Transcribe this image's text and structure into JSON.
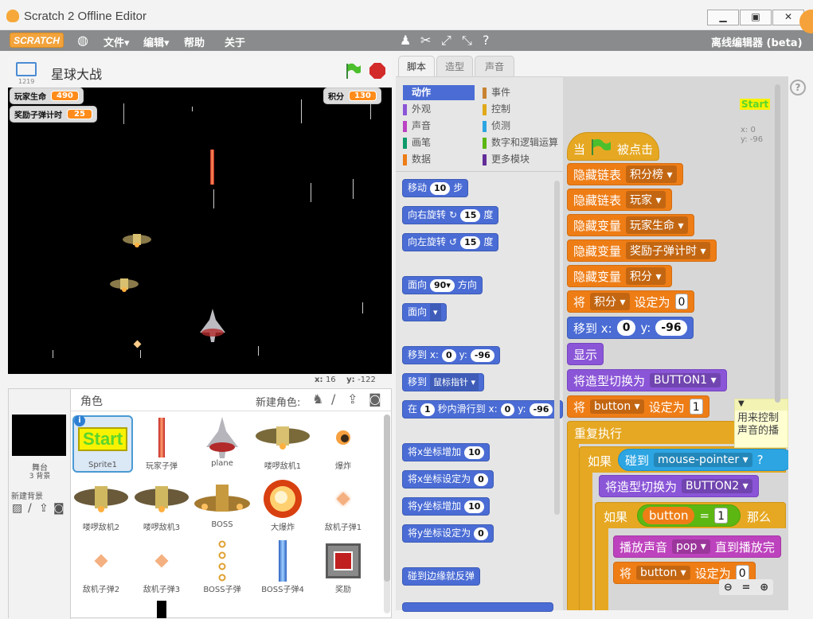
{
  "window": {
    "title": "Scratch 2 Offline Editor"
  },
  "menu": {
    "logo": "SCRATCH",
    "file": "文件▾",
    "edit": "编辑▾",
    "help": "帮助",
    "about": "关于",
    "offline": "离线编辑器 (beta)"
  },
  "stage": {
    "version": "1219",
    "project_name": "星球大战",
    "mouse_x_label": "x:",
    "mouse_x": "16",
    "mouse_y_label": "y:",
    "mouse_y": "-122"
  },
  "monitors": [
    {
      "label": "玩家生命",
      "value": "490"
    },
    {
      "label": "奖励子弹计时",
      "value": "25"
    },
    {
      "label": "积分",
      "value": "130"
    }
  ],
  "sprites_pane": {
    "title": "角色",
    "new_sprite": "新建角色:",
    "stage_label": "舞台",
    "stage_count": "3 背景",
    "new_backdrop": "新建背景"
  },
  "sprites": [
    {
      "name": "Sprite1",
      "selected": true
    },
    {
      "name": "玩家子弹"
    },
    {
      "name": "plane"
    },
    {
      "name": "喽啰敌机1"
    },
    {
      "name": "爆炸"
    },
    {
      "name": "喽啰敌机2"
    },
    {
      "name": "喽啰敌机3"
    },
    {
      "name": "BOSS"
    },
    {
      "name": "大爆炸"
    },
    {
      "name": "敌机子弹1"
    },
    {
      "name": "敌机子弹2"
    },
    {
      "name": "敌机子弹3"
    },
    {
      "name": "BOSS子弹"
    },
    {
      "name": "BOSS子弹4"
    },
    {
      "name": "奖励"
    }
  ],
  "sprite_start_text": "Start",
  "tabs": {
    "scripts": "脚本",
    "costumes": "造型",
    "sounds": "声音"
  },
  "categories": {
    "left": [
      {
        "label": "动作",
        "color": "#4a6cd4",
        "selected": true
      },
      {
        "label": "外观",
        "color": "#8a55d7"
      },
      {
        "label": "声音",
        "color": "#bb42c3"
      },
      {
        "label": "画笔",
        "color": "#0e9a6c"
      },
      {
        "label": "数据",
        "color": "#ee7d16"
      }
    ],
    "right": [
      {
        "label": "事件",
        "color": "#c88330"
      },
      {
        "label": "控制",
        "color": "#e1a91a"
      },
      {
        "label": "侦测",
        "color": "#2ca5e2"
      },
      {
        "label": "数字和逻辑运算",
        "color": "#5cb712"
      },
      {
        "label": "更多模块",
        "color": "#632d99"
      }
    ]
  },
  "palette": {
    "move": "移动",
    "move_steps": "10",
    "steps": "步",
    "turn_right": "向右旋转",
    "turn_right_deg": "15",
    "deg": "度",
    "turn_left": "向左旋转",
    "turn_left_deg": "15",
    "point_dir": "面向",
    "point_dir_val": "90▾",
    "direction": "方向",
    "point_towards": "面向",
    "goto_xy": "移到 x:",
    "goto_x": "0",
    "goto_y_label": "y:",
    "goto_y": "-96",
    "goto": "移到",
    "goto_target": "鼠标指针",
    "glide": "在",
    "glide_secs": "1",
    "glide_mid": "秒内滑行到 x:",
    "glide_x": "0",
    "glide_y_label": "y:",
    "glide_y": "-96",
    "change_x": "将x坐标增加",
    "change_x_val": "10",
    "set_x": "将x坐标设定为",
    "set_x_val": "0",
    "change_y": "将y坐标增加",
    "change_y_val": "10",
    "set_y": "将y坐标设定为",
    "set_y_val": "0",
    "bounce": "碰到边缘就反弹"
  },
  "script": {
    "start_label": "Start",
    "coord_x": "x: 0",
    "coord_y": "y: -96",
    "when": "当",
    "clicked": "被点击",
    "hide_list": "隐藏链表",
    "list1": "积分榜",
    "list2": "玩家",
    "hide_var": "隐藏变量",
    "var1": "玩家生命",
    "var2": "奖励子弹计时",
    "var3": "积分",
    "set": "将",
    "set_var": "积分",
    "set_to": "设定为",
    "set_val": "0",
    "goto": "移到 x:",
    "goto_x": "0",
    "goto_y_label": "y:",
    "goto_y": "-96",
    "show": "显示",
    "switch_costume": "将造型切换为",
    "costume1": "BUTTON1",
    "set2": "将",
    "button_var": "button",
    "set2_to": "设定为",
    "set2_val": "1",
    "forever": "重复执行",
    "if": "如果",
    "touching": "碰到",
    "touch_target": "mouse-pointer",
    "q": "?",
    "switch2": "将造型切换为",
    "costume2": "BUTTON2",
    "if2": "如果",
    "cond_var": "button",
    "eq": "=",
    "cond_val": "1",
    "then": "那么",
    "play_sound": "播放声音",
    "sound": "pop",
    "until_done": "直到播放完",
    "set3": "将",
    "set3_var": "button",
    "set3_to": "设定为",
    "set3_val": "0",
    "comment": "用来控制声音的播"
  }
}
